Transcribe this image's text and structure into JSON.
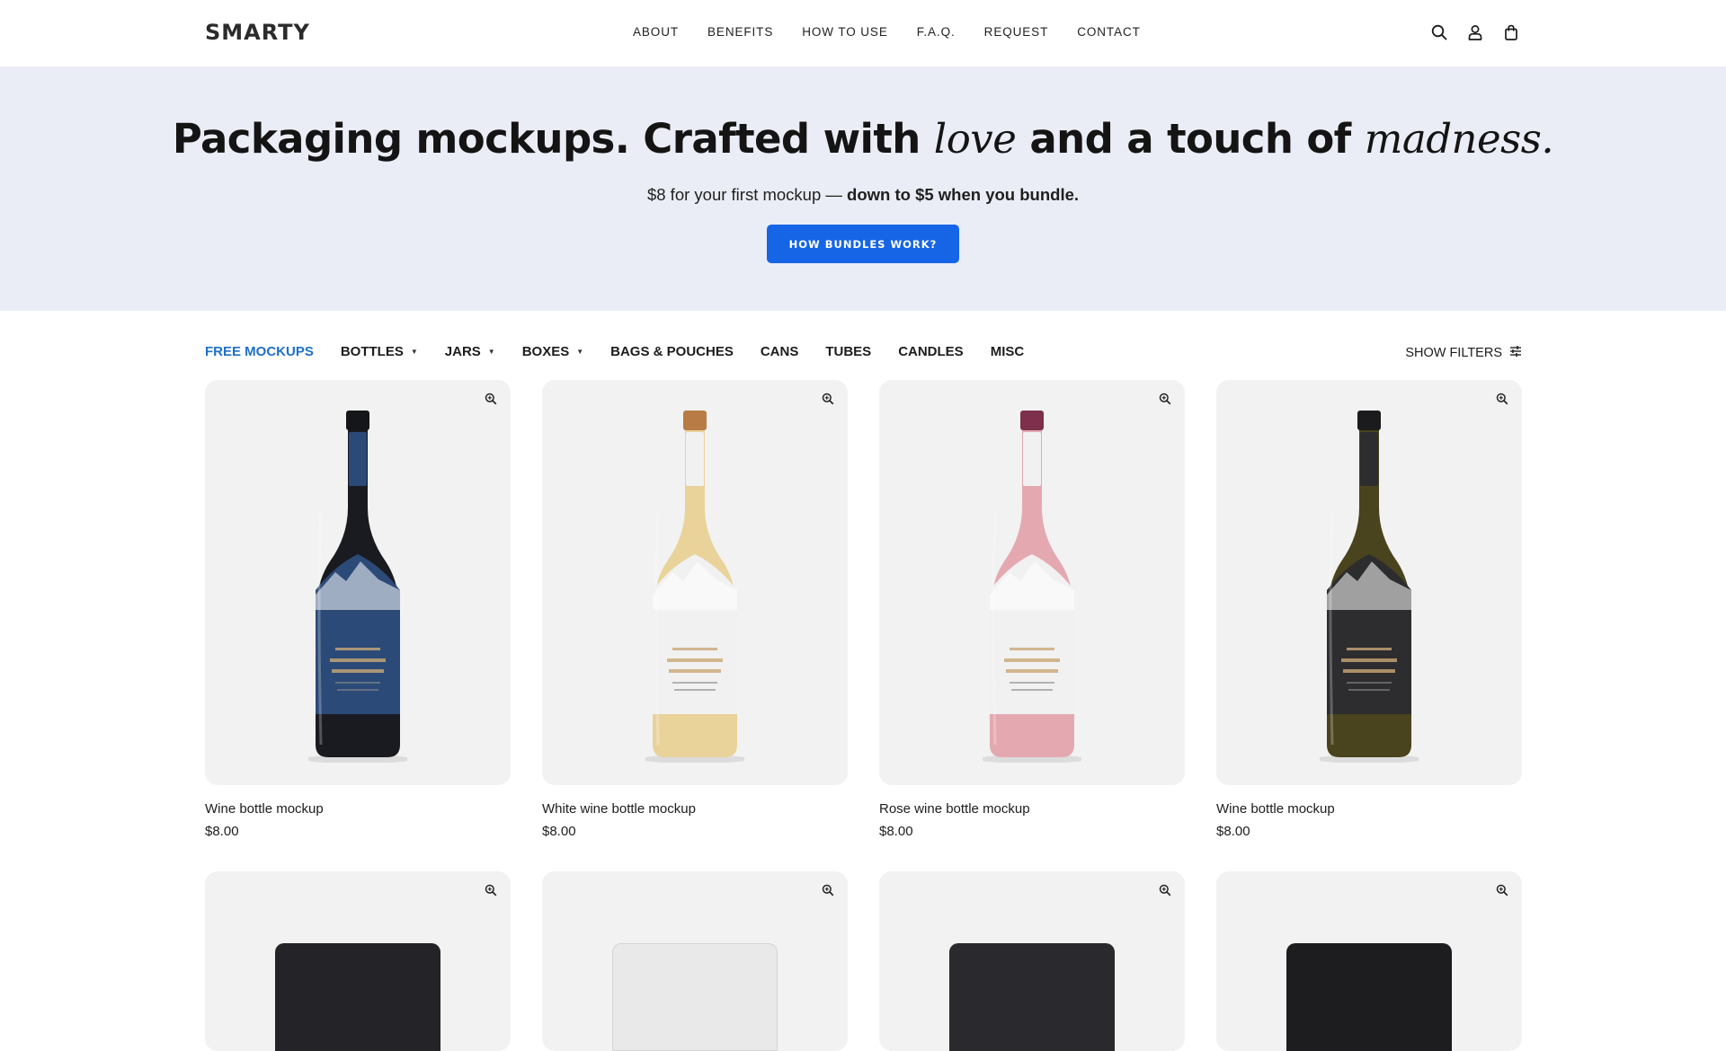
{
  "header": {
    "logo": "SMARTY",
    "nav": [
      "ABOUT",
      "BENEFITS",
      "HOW TO USE",
      "F.A.Q.",
      "REQUEST",
      "CONTACT"
    ],
    "icons": [
      "search-icon",
      "user-icon",
      "bag-icon"
    ]
  },
  "hero": {
    "title_part1": "Packaging mockups. Crafted with ",
    "title_em1": "love",
    "title_part2": " and a touch of ",
    "title_em2": "madness.",
    "sub_part1": "$8 for your first mockup — ",
    "sub_bold": "down to $5 when you bundle.",
    "cta": "HOW BUNDLES WORK?"
  },
  "categories": [
    {
      "label": "FREE MOCKUPS",
      "active": true,
      "dropdown": false
    },
    {
      "label": "BOTTLES",
      "active": false,
      "dropdown": true
    },
    {
      "label": "JARS",
      "active": false,
      "dropdown": true
    },
    {
      "label": "BOXES",
      "active": false,
      "dropdown": true
    },
    {
      "label": "BAGS & POUCHES",
      "active": false,
      "dropdown": false
    },
    {
      "label": "CANS",
      "active": false,
      "dropdown": false
    },
    {
      "label": "TUBES",
      "active": false,
      "dropdown": false
    },
    {
      "label": "CANDLES",
      "active": false,
      "dropdown": false
    },
    {
      "label": "MISC",
      "active": false,
      "dropdown": false
    }
  ],
  "filters_label": "SHOW FILTERS",
  "products": [
    {
      "title": "Wine bottle mockup",
      "price": "$8.00",
      "glass": "#1a1b20",
      "label": "#2c4a78",
      "cap": "#15161a"
    },
    {
      "title": "White wine bottle mockup",
      "price": "$8.00",
      "glass": "#e9d39a",
      "label": "#f1f1f1",
      "cap": "#b97b45"
    },
    {
      "title": "Rose wine bottle mockup",
      "price": "$8.00",
      "glass": "#e4a9b0",
      "label": "#f1f1f1",
      "cap": "#7e2f4c"
    },
    {
      "title": "Wine bottle mockup",
      "price": "$8.00",
      "glass": "#49431e",
      "label": "#2d2d2f",
      "cap": "#1b1b1d"
    }
  ],
  "row2_jars": [
    "#242428",
    "#e9e9e9",
    "#2a2a2e",
    "#1d1d20"
  ]
}
